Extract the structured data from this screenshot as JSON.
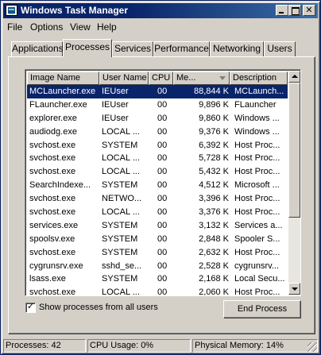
{
  "window": {
    "title": "Windows Task Manager",
    "controls": {
      "close": "✕"
    }
  },
  "menu": [
    "File",
    "Options",
    "View",
    "Help"
  ],
  "tabs": [
    {
      "label": "Applications",
      "active": false
    },
    {
      "label": "Processes",
      "active": true
    },
    {
      "label": "Services",
      "active": false
    },
    {
      "label": "Performance",
      "active": false
    },
    {
      "label": "Networking",
      "active": false
    },
    {
      "label": "Users",
      "active": false
    }
  ],
  "table": {
    "columns": [
      "Image Name",
      "User Name",
      "CPU",
      "Me...",
      "Description"
    ],
    "sorted_column": "Me...",
    "rows": [
      {
        "name": "MCLauncher.exe",
        "user": "IEUser",
        "cpu": "00",
        "mem": "88,844 K",
        "desc": "MCLaunch...",
        "selected": true
      },
      {
        "name": "FLauncher.exe",
        "user": "IEUser",
        "cpu": "00",
        "mem": "9,896 K",
        "desc": "FLauncher"
      },
      {
        "name": "explorer.exe",
        "user": "IEUser",
        "cpu": "00",
        "mem": "9,860 K",
        "desc": "Windows ..."
      },
      {
        "name": "audiodg.exe",
        "user": "LOCAL ...",
        "cpu": "00",
        "mem": "9,376 K",
        "desc": "Windows ..."
      },
      {
        "name": "svchost.exe",
        "user": "SYSTEM",
        "cpu": "00",
        "mem": "6,392 K",
        "desc": "Host Proc..."
      },
      {
        "name": "svchost.exe",
        "user": "LOCAL ...",
        "cpu": "00",
        "mem": "5,728 K",
        "desc": "Host Proc..."
      },
      {
        "name": "svchost.exe",
        "user": "LOCAL ...",
        "cpu": "00",
        "mem": "5,432 K",
        "desc": "Host Proc..."
      },
      {
        "name": "SearchIndexe...",
        "user": "SYSTEM",
        "cpu": "00",
        "mem": "4,512 K",
        "desc": "Microsoft ..."
      },
      {
        "name": "svchost.exe",
        "user": "NETWO...",
        "cpu": "00",
        "mem": "3,396 K",
        "desc": "Host Proc..."
      },
      {
        "name": "svchost.exe",
        "user": "LOCAL ...",
        "cpu": "00",
        "mem": "3,376 K",
        "desc": "Host Proc..."
      },
      {
        "name": "services.exe",
        "user": "SYSTEM",
        "cpu": "00",
        "mem": "3,132 K",
        "desc": "Services a..."
      },
      {
        "name": "spoolsv.exe",
        "user": "SYSTEM",
        "cpu": "00",
        "mem": "2,848 K",
        "desc": "Spooler S..."
      },
      {
        "name": "svchost.exe",
        "user": "SYSTEM",
        "cpu": "00",
        "mem": "2,632 K",
        "desc": "Host Proc..."
      },
      {
        "name": "cygrunsrv.exe",
        "user": "sshd_se...",
        "cpu": "00",
        "mem": "2,528 K",
        "desc": "cygrunsrv..."
      },
      {
        "name": "lsass.exe",
        "user": "SYSTEM",
        "cpu": "00",
        "mem": "2,168 K",
        "desc": "Local Secu..."
      },
      {
        "name": "svchost.exe",
        "user": "LOCAL ...",
        "cpu": "00",
        "mem": "2,060 K",
        "desc": "Host Proc..."
      }
    ]
  },
  "show_all_users": {
    "label": "Show processes from all users",
    "checked": true,
    "check_glyph": "✓"
  },
  "end_process_label": "End Process",
  "status": {
    "processes": "Processes: 42",
    "cpu": "CPU Usage: 0%",
    "memory": "Physical Memory: 14%"
  },
  "colors": {
    "titlebar": "#0a246a",
    "selection": "#0a246a",
    "face": "#d4d0c8"
  }
}
